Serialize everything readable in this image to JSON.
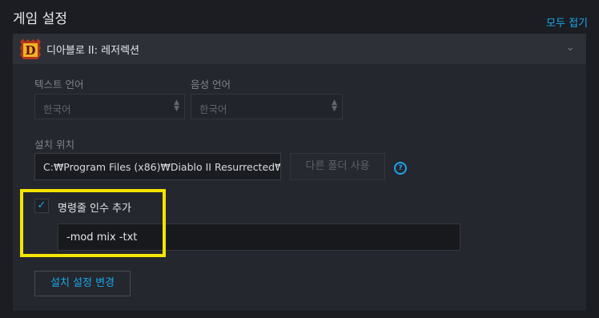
{
  "header": {
    "title": "게임 설정",
    "collapse_all": "모두 접기"
  },
  "game": {
    "name": "디아블로 II: 레저렉션",
    "icon": "diablo-d-icon"
  },
  "text_language": {
    "label": "텍스트 언어",
    "value": "한국어"
  },
  "voice_language": {
    "label": "음성 언어",
    "value": "한국어"
  },
  "install": {
    "label": "설치 위치",
    "path": "C:₩Program Files (x86)₩Diablo II Resurrected₩",
    "other_folder_button": "다른 폴더 사용",
    "help": "?"
  },
  "cmd_args": {
    "checkbox_label": "명령줄 인수 추가",
    "checked": true,
    "value": "-mod mix -txt"
  },
  "change_settings_button": "설치 설정 변경",
  "colors": {
    "accent": "#1aa7ec",
    "highlight": "#f5e400"
  }
}
